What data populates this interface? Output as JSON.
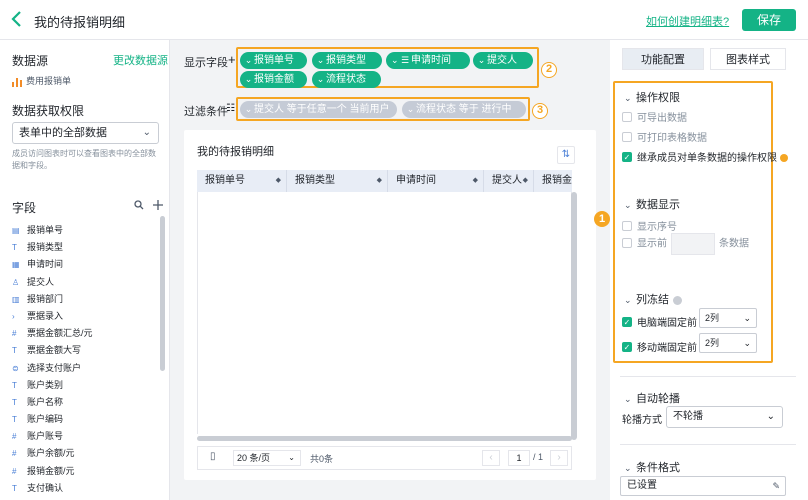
{
  "topbar": {
    "title": "我的待报销明细",
    "help_link": "如何创建明细表?",
    "save_label": "保存"
  },
  "left": {
    "datasource_title": "数据源",
    "change_link": "更改数据源",
    "datasource_item": "费用报销单",
    "perm_title": "数据获取权限",
    "perm_value": "表单中的全部数据",
    "perm_note": "成员访问图表时可以查看图表中的全部数据和字段。",
    "fields_title": "字段",
    "fields": [
      {
        "icon": "text-field-icon",
        "glyph": "▤",
        "label": "报销单号"
      },
      {
        "icon": "text-field-icon",
        "glyph": "T",
        "label": "报销类型"
      },
      {
        "icon": "date-field-icon",
        "glyph": "▦",
        "label": "申请时间"
      },
      {
        "icon": "user-field-icon",
        "glyph": "♙",
        "label": "提交人"
      },
      {
        "icon": "dept-field-icon",
        "glyph": "▥",
        "label": "报销部门"
      },
      {
        "icon": "subform-field-icon",
        "glyph": "›",
        "label": "票据录入"
      },
      {
        "icon": "number-field-icon",
        "glyph": "#",
        "label": "票据金额汇总/元"
      },
      {
        "icon": "text-field-icon",
        "glyph": "T",
        "label": "票据金额大写"
      },
      {
        "icon": "select-field-icon",
        "glyph": "⊜",
        "label": "选择支付账户"
      },
      {
        "icon": "text-field-icon",
        "glyph": "T",
        "label": "账户类别"
      },
      {
        "icon": "text-field-icon",
        "glyph": "T",
        "label": "账户名称"
      },
      {
        "icon": "text-field-icon",
        "glyph": "T",
        "label": "账户编码"
      },
      {
        "icon": "number-field-icon",
        "glyph": "#",
        "label": "账户账号"
      },
      {
        "icon": "number-field-icon",
        "glyph": "#",
        "label": "账户余额/元"
      },
      {
        "icon": "number-field-icon",
        "glyph": "#",
        "label": "报销金额/元"
      },
      {
        "icon": "text-field-icon",
        "glyph": "T",
        "label": "支付确认"
      }
    ]
  },
  "center": {
    "display_label": "显示字段",
    "display_pills": [
      {
        "label": "报销单号",
        "glyph": "⌄"
      },
      {
        "label": "报销类型",
        "glyph": "⌄"
      },
      {
        "label": "申请时间",
        "glyph": "⌄ ☰"
      },
      {
        "label": "提交人",
        "glyph": "⌄"
      },
      {
        "label": "报销金额",
        "glyph": "⌄"
      },
      {
        "label": "流程状态",
        "glyph": "⌄"
      }
    ],
    "filter_label": "过滤条件",
    "filter_pills": [
      {
        "label": "提交人 等于任意一个 当前用户",
        "glyph": "⌄"
      },
      {
        "label": "流程状态 等于 进行中",
        "glyph": "⌄"
      }
    ],
    "badges": [
      "2",
      "3"
    ],
    "card_title": "我的待报销明细",
    "columns": [
      "报销单号",
      "报销类型",
      "申请时间",
      "提交人",
      "报销金"
    ],
    "page_size": "20 条/页",
    "total": "共0条",
    "page": "1",
    "page_of": "/ 1"
  },
  "right": {
    "tab_config": "功能配置",
    "tab_style": "图表样式",
    "badge": "1",
    "perm_section": "操作权限",
    "perm_options": [
      {
        "label": "可导出数据",
        "checked": false
      },
      {
        "label": "可打印表格数据",
        "checked": false
      },
      {
        "label": "继承成员对单条数据的操作权限",
        "checked": true
      }
    ],
    "display_section": "数据显示",
    "show_index": "显示序号",
    "show_first": "显示前",
    "show_first_suffix": "条数据",
    "freeze_section": "列冻结",
    "freeze_pc": "电脑端固定前",
    "freeze_pc_value": "2列",
    "freeze_mobile": "移动端固定前",
    "freeze_mobile_value": "2列",
    "carousel_section": "自动轮播",
    "carousel_label": "轮播方式",
    "carousel_value": "不轮播",
    "cond_section": "条件格式",
    "cond_value": "已设置"
  },
  "colors": {
    "accent": "#14b386",
    "highlight": "#f5a623",
    "datasource_bar": "#f28c28"
  }
}
